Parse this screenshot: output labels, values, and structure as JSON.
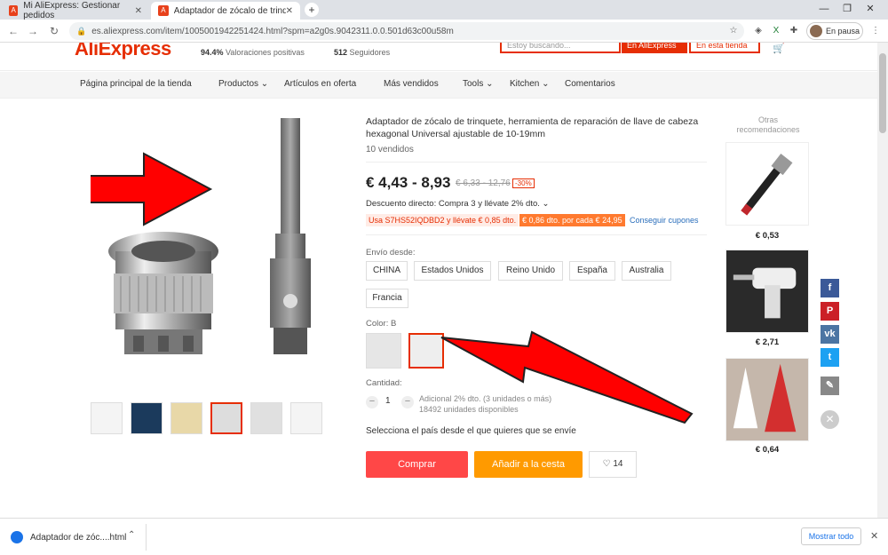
{
  "browser": {
    "tabs": [
      {
        "label": "Mi AliExpress: Gestionar pedidos",
        "active": false
      },
      {
        "label": "Adaptador de zócalo de trinquete...",
        "active": true
      }
    ],
    "url": "es.aliexpress.com/item/1005001942251424.html?spm=a2g0s.9042311.0.0.501d63c00u58m",
    "profile_label": "En pausa",
    "nav_icons": [
      "back-icon",
      "forward-icon",
      "reload-icon"
    ]
  },
  "store": {
    "logo": "AliExpress",
    "feedback_pct": "94.4%",
    "feedback_label": "Valoraciones positivas",
    "followers_count": "512",
    "followers_label": "Seguidores",
    "search_placeholder": "Estoy buscando...",
    "search_aliexpress": "En AliExpress",
    "search_store": "En esta tienda"
  },
  "catnav": [
    "Página principal de la tienda",
    "Productos",
    "Artículos en oferta",
    "Más vendidos",
    "Tools",
    "Kitchen",
    "Comentarios"
  ],
  "product": {
    "title": "Adaptador de zócalo de trinquete, herramienta de reparación de llave de cabeza hexagonal Universal ajustable de 10-19mm",
    "sold": "10 vendidos",
    "price": "€ 4,43 - 8,93",
    "old_price": "€ 6,33 - 12,76",
    "discount": "-30%",
    "direct_discount": "Descuento directo: Compra 3 y llévate 2% dto. ⌄",
    "coupon_code": "Usa S7HS52IQDBD2 y llévate € 0,85 dto.",
    "coupon_store": "€ 0,86 dto. por cada € 24,95",
    "coupon_link": "Conseguir cupones",
    "ship_from_label": "Envío desde:",
    "ship_options": [
      "CHINA",
      "Estados Unidos",
      "Reino Unido",
      "España",
      "Australia",
      "Francia"
    ],
    "color_label": "Color: B",
    "quantity_label": "Cantidad:",
    "quantity_value": "1",
    "quantity_extra": "Adicional 2% dto. (3 unidades o más)",
    "quantity_available": "18492 unidades disponibles",
    "ship_note": "Selecciona el país desde el que quieres que se envíe",
    "buy_label": "Comprar",
    "cart_label": "Añadir a la cesta",
    "wishlist_count": "14"
  },
  "recommendations": {
    "title": "Otras recomendaciones",
    "items": [
      {
        "price": "€ 0,53"
      },
      {
        "price": "€ 2,71"
      },
      {
        "price": "€ 0,64"
      }
    ]
  },
  "social": [
    "facebook-icon",
    "pinterest-icon",
    "vk-icon",
    "twitter-icon",
    "edit-icon"
  ],
  "download": {
    "filename": "Adaptador de zóc....html",
    "show_all": "Mostrar todo"
  },
  "colors": {
    "brand": "#e62e04",
    "buy": "#ff4747",
    "cart": "#ff9a00",
    "arrow": "#ff0000"
  }
}
